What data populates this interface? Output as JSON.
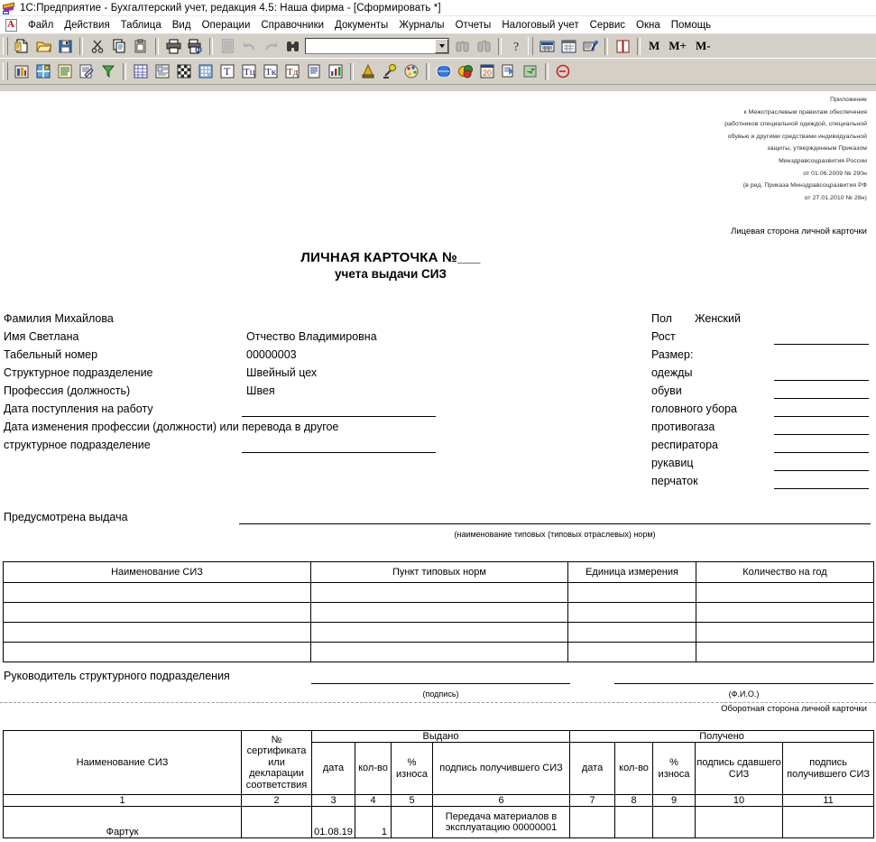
{
  "window": {
    "title": "1С:Предприятие - Бухгалтерский учет, редакция 4.5: Наша фирма - [Сформировать  *]",
    "app_icon": "1c-logo-icon"
  },
  "menu": {
    "app_icon": "document-red-a-icon",
    "items": [
      "Файл",
      "Действия",
      "Таблица",
      "Вид",
      "Операции",
      "Справочники",
      "Документы",
      "Журналы",
      "Отчеты",
      "Налоговый учет",
      "Сервис",
      "Окна",
      "Помощь"
    ]
  },
  "toolbar1": {
    "buttons": [
      "new-document-icon",
      "open-folder-icon",
      "save-disk-icon",
      "cut-scissors-icon",
      "copy-icon",
      "paste-clipboard-icon",
      "print-icon",
      "print-preview-icon",
      "select-all-icon",
      "undo-icon",
      "redo-icon",
      "find-binoculars-icon"
    ],
    "search_value": "",
    "search_placeholder": "",
    "dropdown_icon": "chevron-down-icon",
    "buttons_after": [
      "find-previous-icon",
      "find-next-icon",
      "help-question-icon",
      "calculator-icon",
      "calendar-icon",
      "query-wizard-icon",
      "address-book-icon"
    ],
    "memory_buttons": [
      "M",
      "M+",
      "M-"
    ]
  },
  "toolbar2": {
    "buttons": [
      "accounts-icon",
      "chart-of-accounts-icon",
      "journal-icon",
      "report-edit-icon",
      "filter-icon",
      "spreadsheet-icon",
      "card-icon",
      "checkerboard-icon",
      "building-icon",
      "text-cell-icon",
      "text-cell-sum-icon",
      "text-cell-align-icon",
      "text-cell-format-icon",
      "document-text-icon",
      "bar-chart-icon",
      "cone-icon",
      "antenna-icon",
      "palette-icon",
      "planet-icon",
      "colors-icon",
      "calendar20-icon",
      "export-icon",
      "import-arrow-icon",
      "exit-circle-icon"
    ]
  },
  "document": {
    "header_note": [
      "Приложение",
      "к Межотраслевым правилам обеспечения",
      "работников специальной одеждой, специальной",
      "обувью и другими средствами индивидуальной",
      "защиты, утвержденным Приказом",
      "Минздравсоцразвития России",
      "от 01.06.2009 № 290н",
      "(в ред. Приказа Минздравсоцразвития РФ",
      "от 27.01.2010 № 28н)"
    ],
    "side_note_front": "Лицевая сторона личной карточки",
    "side_note_back": "Оборотная сторона личной карточки",
    "title_line1": "ЛИЧНАЯ КАРТОЧКА №___",
    "title_line2": "учета выдачи СИЗ",
    "fields_left": [
      {
        "label": "Фамилия Михайлова",
        "value": ""
      },
      {
        "label": "Имя Светлана",
        "value": "Отчество Владимировна"
      },
      {
        "label": "Табельный номер",
        "value": "00000003"
      },
      {
        "label": "Структурное подразделение",
        "value": "Швейный цех"
      },
      {
        "label": "Профессия (должность)",
        "value": "Швея"
      },
      {
        "label": "Дата поступления на работу",
        "value": ""
      },
      {
        "label": "Дата изменения профессии (должности) или перевода в другое",
        "value": ""
      },
      {
        "label": "структурное подразделение",
        "value": ""
      }
    ],
    "fields_right": [
      {
        "label": "Пол",
        "value": "Женский"
      },
      {
        "label": "Рост",
        "value": ""
      },
      {
        "label": "Размер:",
        "value": ""
      },
      {
        "label": "одежды",
        "value": ""
      },
      {
        "label": "обуви",
        "value": ""
      },
      {
        "label": "головного убора",
        "value": ""
      },
      {
        "label": "противогаза",
        "value": ""
      },
      {
        "label": "респиратора",
        "value": ""
      },
      {
        "label": "рукавиц",
        "value": ""
      },
      {
        "label": "перчаток",
        "value": ""
      }
    ],
    "issue_label": "Предусмотрена выдача",
    "issue_value": "",
    "issue_caption": "(наименование типовых (типовых отраслевых) норм)",
    "norms_table": {
      "headers": [
        "Наименование СИЗ",
        "Пункт типовых норм",
        "Единица измерения",
        "Количество на год"
      ],
      "rows": [
        [
          "",
          "",
          "",
          ""
        ],
        [
          "",
          "",
          "",
          ""
        ],
        [
          "",
          "",
          "",
          ""
        ],
        [
          "",
          "",
          "",
          ""
        ]
      ]
    },
    "manager_label": "Руководитель структурного подразделения",
    "manager_signature": "",
    "manager_name": "",
    "caption_signature": "(подпись)",
    "caption_fio": "(Ф.И.О.)",
    "issue_table": {
      "col_name": "Наименование СИЗ",
      "col_cert": "№ сертификата или декларации соответствия",
      "group_issued": "Выдано",
      "group_received": "Получено",
      "sub_issued": [
        "дата",
        "кол-во",
        "% износа",
        "подпись получившего СИЗ"
      ],
      "sub_received": [
        "дата",
        "кол-во",
        "% износа",
        "подпись сдавшего СИЗ",
        "подпись получившего СИЗ"
      ],
      "numbers": [
        "1",
        "2",
        "3",
        "4",
        "5",
        "6",
        "7",
        "8",
        "9",
        "10",
        "11"
      ],
      "rows": [
        {
          "name": "Фартук",
          "cert": "",
          "issued_date": "01.08.19",
          "issued_qty": "1",
          "issued_wear": "",
          "issued_sign": "Передача материалов в эксплуатацию 00000001",
          "received_date": "",
          "received_qty": "",
          "received_wear": "",
          "received_sign_giver": "",
          "received_sign_taker": ""
        }
      ]
    }
  }
}
